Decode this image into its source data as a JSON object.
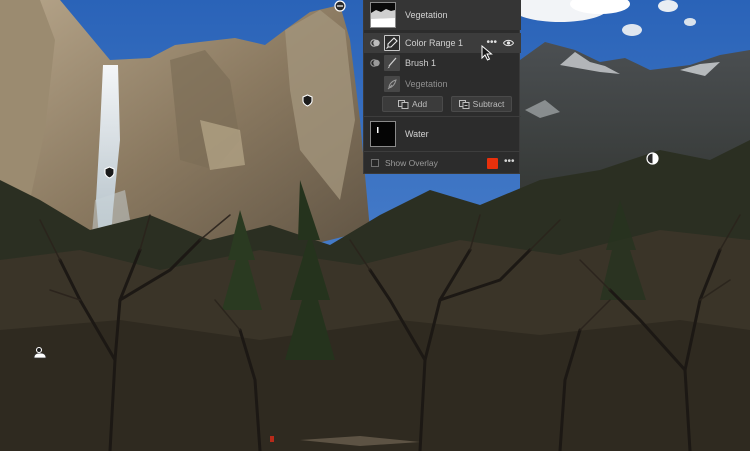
{
  "masks_panel": {
    "masks": [
      {
        "name": "Vegetation",
        "components": [
          {
            "name": "Color Range 1",
            "type": "color-range",
            "operation": "add",
            "hovered": true
          },
          {
            "name": "Brush 1",
            "type": "brush",
            "operation": "add"
          },
          {
            "name": "Vegetation",
            "type": "vegetation",
            "operation": "add",
            "dimmed": true
          }
        ],
        "add_label": "Add",
        "subtract_label": "Subtract"
      },
      {
        "name": "Water"
      }
    ],
    "show_overlay_label": "Show Overlay",
    "show_overlay_checked": false,
    "overlay_color": "#e8300c",
    "more_glyph": "•••"
  },
  "colors": {
    "panel_bg": "#2c2c2c",
    "accent_overlay": "#e8300c"
  }
}
